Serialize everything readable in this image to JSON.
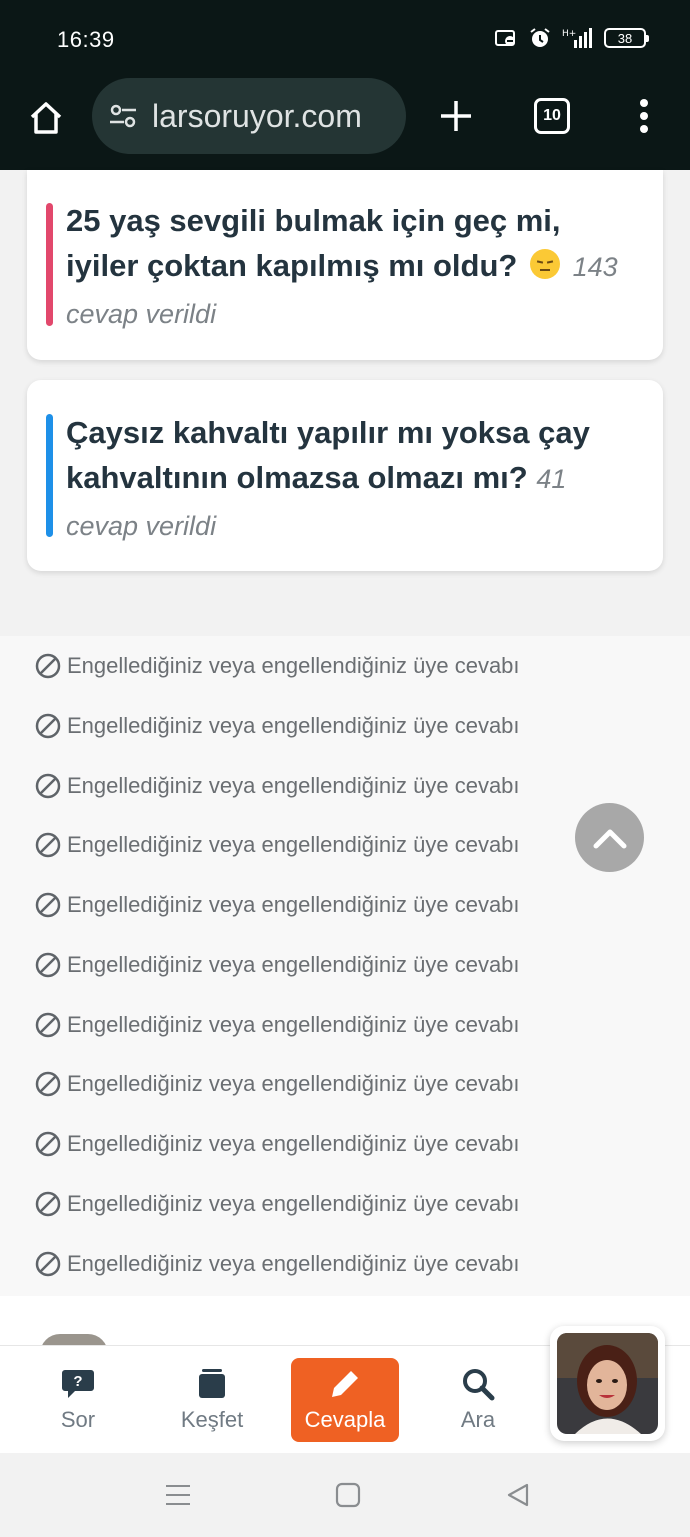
{
  "status_bar": {
    "time": "16:39",
    "battery": "38",
    "icons": [
      "notification-off-icon",
      "alarm-icon",
      "signal-icon",
      "battery-icon"
    ]
  },
  "browser": {
    "url": "larsoruyor.com",
    "tab_count": "10"
  },
  "cards": [
    {
      "title": "25 yaş sevgili bulmak için geç mi, iyiler çoktan kapılmış mı oldu?",
      "emoji": "pensive-face",
      "count": "143 cevap verildi",
      "accent": "#e2486c"
    },
    {
      "title": "Çaysız kahvaltı yapılır mı yoksa çay kahvaltının olmazsa olmazı mı?",
      "count": "41 cevap verildi",
      "accent": "#1e90e8"
    }
  ],
  "blocked": [
    "Engellediğiniz veya engellendiğiniz üye cevabı",
    "Engellediğiniz veya engellendiğiniz üye cevabı",
    "Engellediğiniz veya engellendiğiniz üye cevabı",
    "Engellediğiniz veya engellendiğiniz üye cevabı",
    "Engellediğiniz veya engellendiğiniz üye cevabı",
    "Engellediğiniz veya engellendiğiniz üye cevabı",
    "Engellediğiniz veya engellendiğiniz üye cevabı",
    "Engellediğiniz veya engellendiğiniz üye cevabı",
    "Engellediğiniz veya engellendiğiniz üye cevabı",
    "Engellediğiniz veya engellendiğiniz üye cevabı",
    "Engellediğiniz veya engellendiğiniz üye cevabı"
  ],
  "bottom_nav": {
    "sor": "Sor",
    "kesfet": "Keşfet",
    "cevapla": "Cevapla",
    "ara": "Ara"
  },
  "colors": {
    "primary_action": "#ef6123",
    "browser_bar": "#0b1716"
  }
}
